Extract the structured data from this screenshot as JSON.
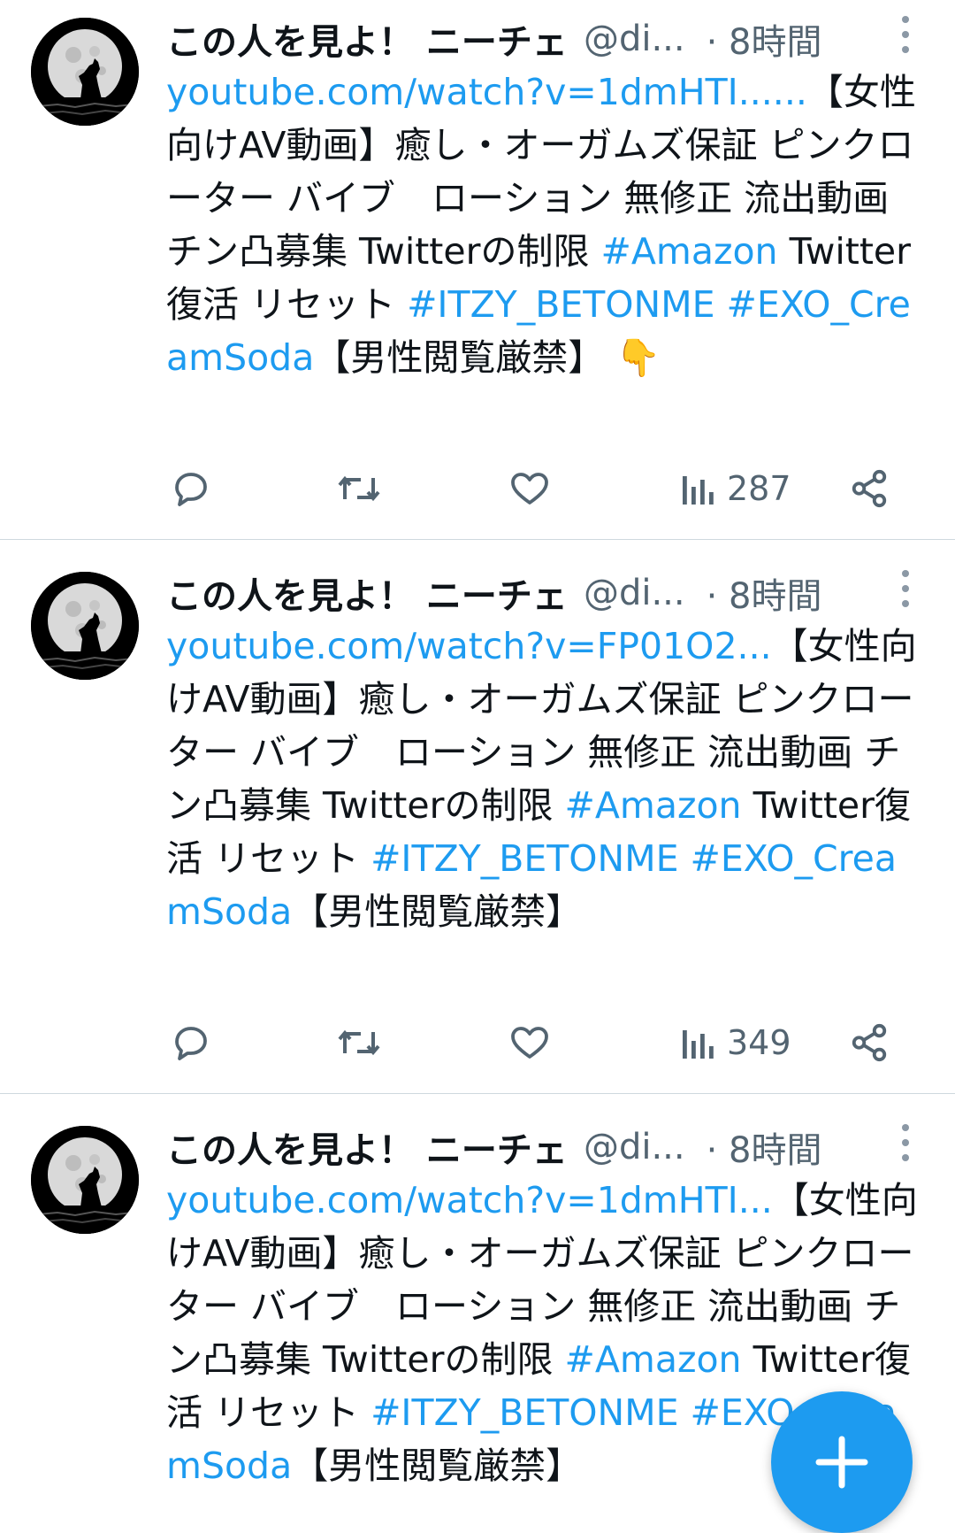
{
  "tweets": [
    {
      "name": "この人を見よ！ ニーチェ",
      "handle": "@di...",
      "time": "· 8時間",
      "link": "youtube.com/watch?v=1dmHTI......",
      "text1": "【女性向けAV動画】癒し・オーガムズ保証 ピンクローター バイブ　ローション 無修正 流出動画 チン凸募集 Twitterの制限 ",
      "tag1": "#Amazon",
      "text2": " Twitter復活 リセット ",
      "tag2": "#ITZY_BETONME",
      "tag3": "#EXO_CreamSoda",
      "text3": "【男性閲覧厳禁】",
      "emoji": "👇",
      "views": "287"
    },
    {
      "name": "この人を見よ！ ニーチェ",
      "handle": "@di...",
      "time": "· 8時間",
      "link": "youtube.com/watch?v=FP01O2...",
      "text1": "【女性向けAV動画】癒し・オーガムズ保証 ピンクローター バイブ　ローション 無修正 流出動画 チン凸募集 Twitterの制限 ",
      "tag1": "#Amazon",
      "text2": " Twitter復活 リセット ",
      "tag2": "#ITZY_BETONME",
      "tag3": "#EXO_CreamSoda",
      "text3": "【男性閲覧厳禁】",
      "views": "349"
    },
    {
      "name": "この人を見よ！ ニーチェ",
      "handle": "@di...",
      "time": "· 8時間",
      "link": "youtube.com/watch?v=1dmHTI...",
      "text1": "【女性向けAV動画】癒し・オーガムズ保証 ピンクローター バイブ　ローション 無修正 流出動画 チン凸募集 Twitterの制限 ",
      "tag1": "#Amazon",
      "text2": " Twitter復活 リセット ",
      "tag2": "#ITZY_BETONME",
      "tag3": "#EXO_CreamSoda",
      "text3": "【男性閲覧厳禁】"
    }
  ],
  "icons": {
    "reply": "reply-icon",
    "retweet": "retweet-icon",
    "like": "like-icon",
    "views": "views-icon",
    "share": "share-icon",
    "more": "more-icon",
    "compose": "compose-icon"
  },
  "colors": {
    "accent": "#1d9bf0",
    "muted": "#536471",
    "text": "#0f1419",
    "divider": "#cfd9de"
  }
}
